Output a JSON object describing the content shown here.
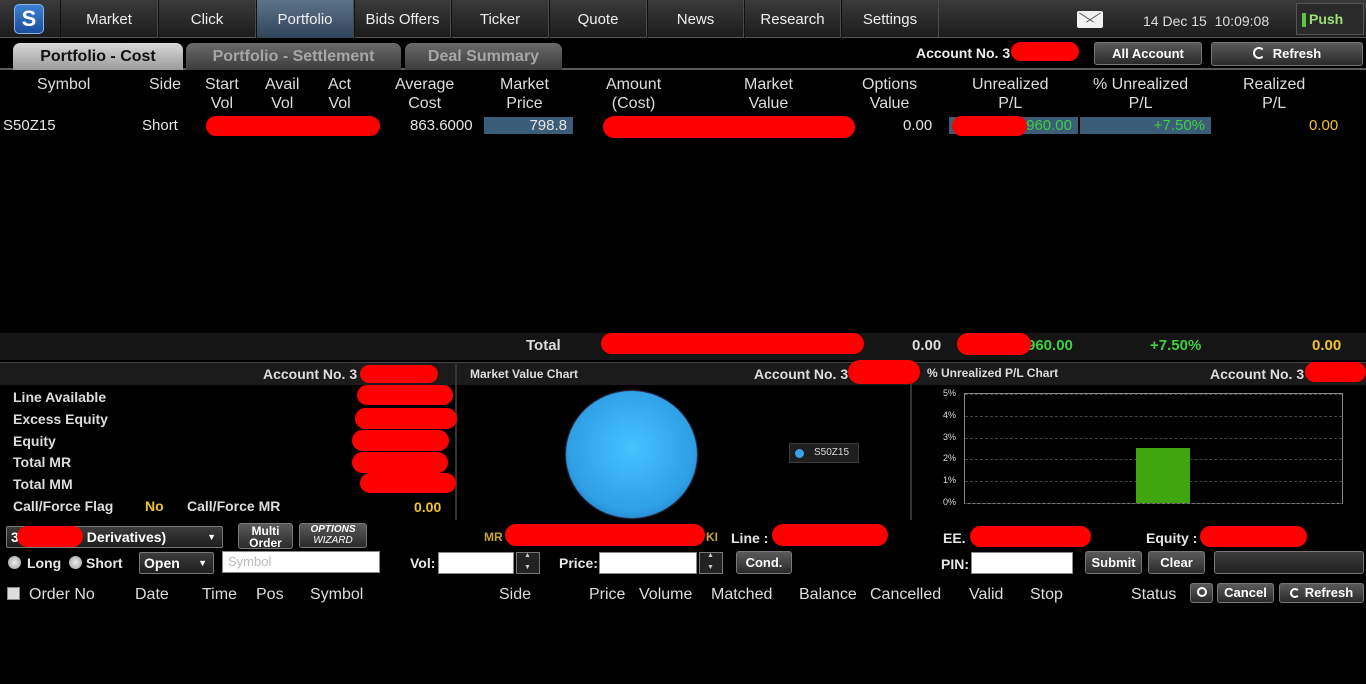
{
  "nav": {
    "tabs": [
      "Market",
      "Click",
      "Portfolio",
      "Bids Offers",
      "Ticker",
      "Quote",
      "News",
      "Research",
      "Settings"
    ],
    "date": "14 Dec 15",
    "time": "10:09:08",
    "push": "Push"
  },
  "subtabs": [
    "Portfolio - Cost",
    "Portfolio - Settlement",
    "Deal Summary"
  ],
  "account": {
    "label_partial": "Account No. 3",
    "all_account": "All Account",
    "refresh": "Refresh"
  },
  "table": {
    "headers": {
      "symbol": "Symbol",
      "side": "Side",
      "start_vol": "Start\nVol",
      "avail_vol": "Avail\nVol",
      "act_vol": "Act\nVol",
      "avg_cost": "Average\nCost",
      "mkt_price": "Market\nPrice",
      "amount_cost": "Amount\n(Cost)",
      "mkt_value": "Market\nValue",
      "options_value": "Options\nValue",
      "unrealized": "Unrealized\nP/L",
      "pct_unrealized": "% Unrealized\nP/L",
      "realized": "Realized\nP/L"
    },
    "row": {
      "symbol": "S50Z15",
      "side": "Short",
      "avg_cost": "863.6000",
      "mkt_price": "798.8",
      "options_value": "0.00",
      "unrealized_partial": "960.00",
      "pct_unrealized": "+7.50%",
      "realized": "0.00"
    },
    "total": {
      "label": "Total",
      "options_value": "0.00",
      "unrealized_partial": "960.00",
      "pct_unrealized": "+7.50%",
      "realized": "0.00"
    }
  },
  "summary": {
    "account_label": "Account No. 3",
    "rows": [
      "Line Available",
      "Excess Equity",
      "Equity",
      "Total MR",
      "Total MM"
    ],
    "flag_label": "Call/Force Flag",
    "flag_value": "No",
    "force_mr_label": "Call/Force MR",
    "force_mr_value": "0.00"
  },
  "mv_chart": {
    "title": "Market Value Chart",
    "account_label": "Account No. 3",
    "legend": "S50Z15"
  },
  "pl_chart": {
    "title": "% Unrealized P/L Chart",
    "account_label": "Account No. 3",
    "y_ticks": [
      "5%",
      "4%",
      "3%",
      "2%",
      "1%",
      "0%"
    ]
  },
  "chart_data": {
    "type": "bar",
    "title": "% Unrealized P/L Chart",
    "categories": [
      "S50Z15"
    ],
    "values": [
      2.5
    ],
    "ylim": [
      0,
      5
    ],
    "grid": true,
    "color": "#3fa60f"
  },
  "order": {
    "account_partial": "3",
    "account_suffix": "Derivatives)",
    "multi_order": "Multi\nOrder",
    "options_wizard_top": "OPTIONS",
    "options_wizard_bottom": "WIZARD",
    "mr_label": "MR",
    "ki_label": "KI",
    "line_label": "Line :",
    "ee_label": "EE.",
    "equity_label": "Equity :",
    "long": "Long",
    "short": "Short",
    "open": "Open",
    "symbol_placeholder": "Symbol",
    "vol_label": "Vol:",
    "price_label": "Price:",
    "cond": "Cond.",
    "pin_label": "PIN:",
    "submit": "Submit",
    "clear": "Clear"
  },
  "orders_table": {
    "headers": [
      "Order No",
      "Date",
      "Time",
      "Pos",
      "Symbol",
      "Side",
      "Price",
      "Volume",
      "Matched",
      "Balance",
      "Cancelled",
      "Valid",
      "Stop",
      "Status"
    ],
    "cancel": "Cancel",
    "refresh": "Refresh"
  }
}
